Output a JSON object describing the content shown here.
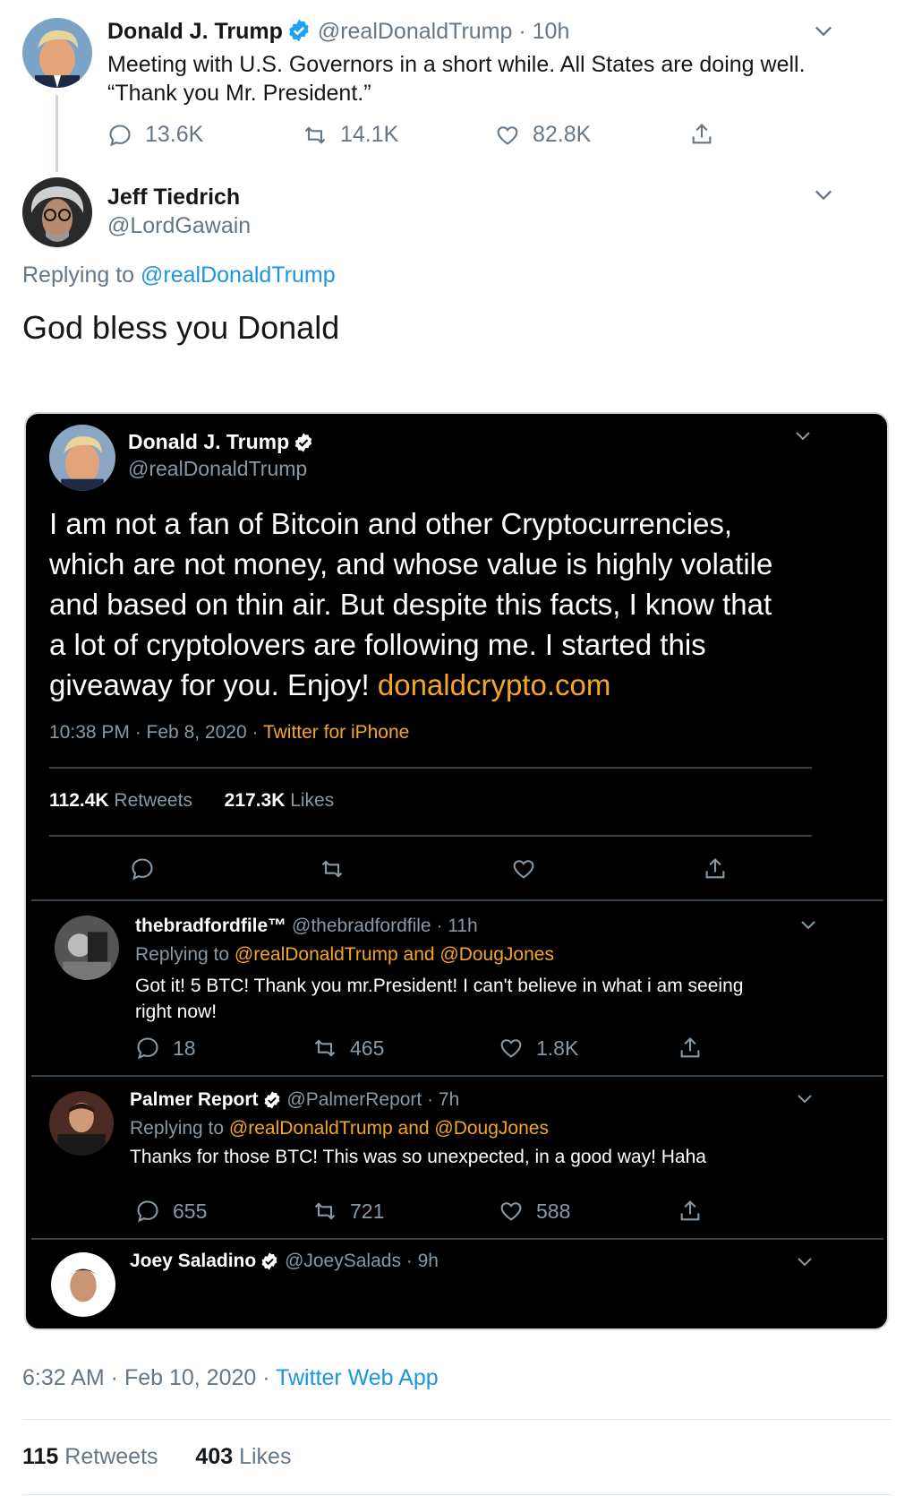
{
  "main_tweet": {
    "name": "Donald J. Trump",
    "handle": "@realDonaldTrump",
    "time": "· 10h",
    "text_line1": "Meeting with U.S. Governors in a short while. All States are doing well.",
    "text_line2": "“Thank you Mr. President.”",
    "replies": "13.6K",
    "retweets": "14.1K",
    "likes": "82.8K"
  },
  "reply_tweet": {
    "name": "Jeff Tiedrich",
    "handle": "@LordGawain",
    "replying_prefix": "Replying to",
    "replying_to": "@realDonaldTrump",
    "text": "God bless you Donald",
    "timestamp": "6:32 AM · Feb 10, 2020 ·",
    "source": "Twitter Web App",
    "retweets_count": "115",
    "retweets_label": "Retweets",
    "likes_count": "403",
    "likes_label": "Likes"
  },
  "embedded": {
    "name": "Donald J. Trump",
    "handle": "@realDonaldTrump",
    "text_lines": [
      "I am not a fan of Bitcoin and other Cryptocurrencies,",
      "which are not money, and whose value is highly volatile",
      "and based on thin air. But despite this facts, I know that",
      "a lot of cryptolovers are following me. I started this",
      "giveaway for you. Enjoy!"
    ],
    "link": "donaldcrypto.com",
    "meta": "10:38 PM · Feb 8, 2020 ·",
    "source": "Twitter for iPhone",
    "retweets_count": "112.4K",
    "retweets_label": "Retweets",
    "likes_count": "217.3K",
    "likes_label": "Likes",
    "replies": [
      {
        "name": "thebradfordfile™",
        "handle": "@thebradfordfile · 11h",
        "replying_prefix": "Replying to",
        "replying_to": "@realDonaldTrump and @DougJones",
        "text_line1": "Got it! 5 BTC! Thank you mr.President! I can't believe in what i am seeing",
        "text_line2": "right now!",
        "reply_count": "18",
        "retweet_count": "465",
        "like_count": "1.8K"
      },
      {
        "name": "Palmer Report",
        "handle": "@PalmerReport · 7h",
        "replying_prefix": "Replying to",
        "replying_to": "@realDonaldTrump and @DougJones",
        "text_line1": "Thanks for those BTC! This was so unexpected, in a good way! Haha",
        "reply_count": "655",
        "retweet_count": "721",
        "like_count": "588"
      },
      {
        "name": "Joey Saladino",
        "handle": "@JoeySalads · 9h"
      }
    ]
  },
  "colors": {
    "link_blue": "#1b95e0",
    "muted_gray": "#657786",
    "dark_bg": "#000000",
    "dark_link_orange": "#f5a623",
    "verified_blue": "#1da1f2"
  },
  "icons": [
    "comment-icon",
    "retweet-icon",
    "heart-icon",
    "share-icon",
    "chevron-down-icon",
    "verified-badge-icon"
  ]
}
